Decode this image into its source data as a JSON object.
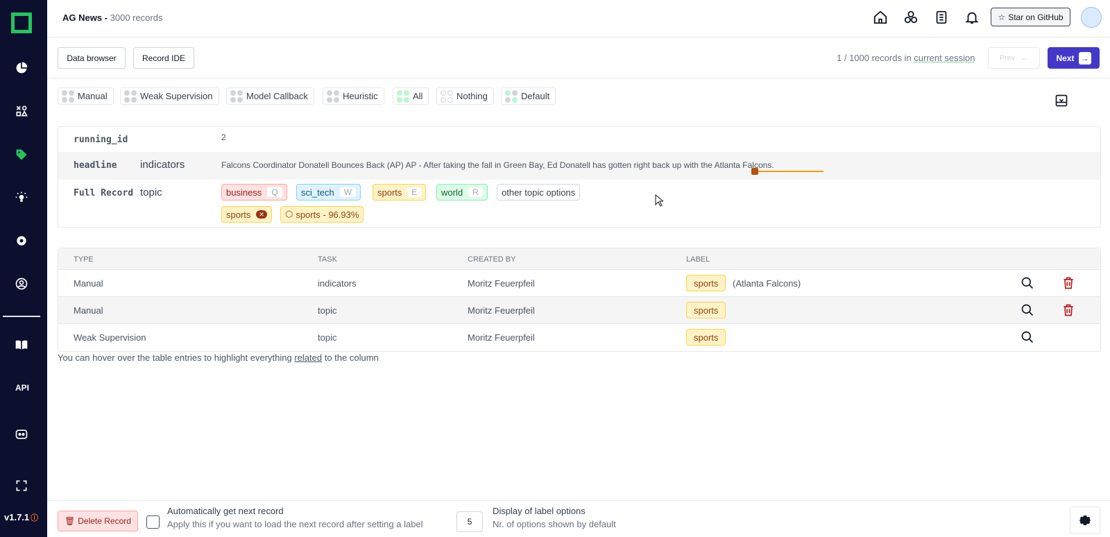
{
  "app": {
    "project_name": "AG News - ",
    "record_count": "3000 records",
    "version": "v1.7.1",
    "star_label": "Star on GitHub"
  },
  "toolbar": {
    "data_browser": "Data browser",
    "record_ide": "Record IDE",
    "session_prefix": "1 / 1000 records in ",
    "session_link": "current session",
    "prev": "Prev",
    "next": "Next"
  },
  "filters": [
    "Manual",
    "Weak Supervision",
    "Model Callback",
    "Heuristic",
    "All",
    "Nothing",
    "Default"
  ],
  "record": {
    "running_id_key": "running_id",
    "running_id_value": "2",
    "headline_key": "headline",
    "headline_task": "indicators",
    "headline_value": "Falcons Coordinator Donatell Bounces Back (AP) AP - After taking the fall in Green Bay, Ed Donatell has gotten right back up with the Atlanta Falcons.",
    "full_record_key": "Full Record",
    "topic_task": "topic",
    "options": [
      {
        "label": "business",
        "key": "Q"
      },
      {
        "label": "sci_tech",
        "key": "W"
      },
      {
        "label": "sports",
        "key": "E"
      },
      {
        "label": "world",
        "key": "R"
      }
    ],
    "other_options": "other topic options",
    "assigned_label": "sports",
    "assigned_remove": "✕",
    "prediction": "sports - 96.93%"
  },
  "table": {
    "headers": {
      "type": "TYPE",
      "task": "TASK",
      "created_by": "CREATED BY",
      "label": "LABEL"
    },
    "rows": [
      {
        "type": "Manual",
        "task": "indicators",
        "created_by": "Moritz Feuerpfeil",
        "label": "sports",
        "span": "(Atlanta Falcons)"
      },
      {
        "type": "Manual",
        "task": "topic",
        "created_by": "Moritz Feuerpfeil",
        "label": "sports",
        "span": ""
      },
      {
        "type": "Weak Supervision",
        "task": "topic",
        "created_by": "Moritz Feuerpfeil",
        "label": "sports",
        "span": ""
      }
    ],
    "hint_prefix": "You can hover over the table entries to highlight everything ",
    "hint_link": "related",
    "hint_suffix": " to the column"
  },
  "footer": {
    "delete": "Delete Record",
    "auto_next_title": "Automatically get next record",
    "auto_next_sub": "Apply this if you want to load the next record after setting a label",
    "display_value": "5",
    "display_title": "Display of label options",
    "display_sub": "Nr. of options shown by default"
  },
  "sidebar_api": "API",
  "colors": {
    "accent": "#4338ca",
    "brand": "#22c55e",
    "sidebar": "#0c0f2e",
    "delete": "#b91c1c"
  }
}
